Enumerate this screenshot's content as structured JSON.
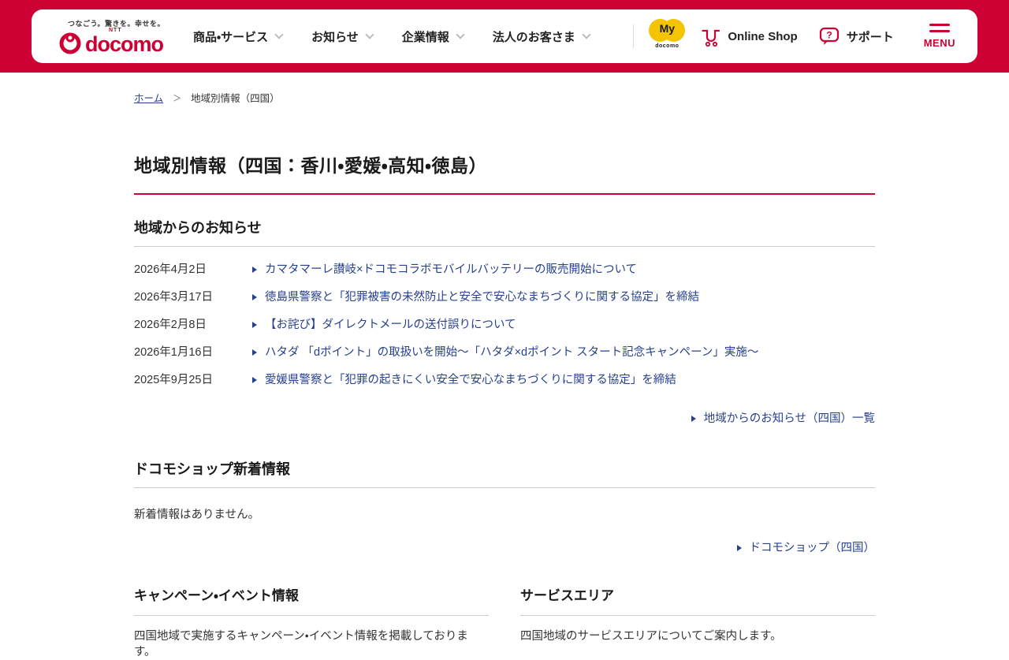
{
  "header": {
    "tagline": "つなごう。驚きを。幸せを。",
    "logo_ntt": "NTT",
    "logo_text": "docomo",
    "nav": [
      "商品・サービス",
      "お知らせ",
      "企業情報",
      "法人のお客さま"
    ],
    "my_docomo": {
      "my": "My",
      "sub": "docomo"
    },
    "online_shop_label": "Online Shop",
    "support_label": "サポート",
    "menu_label": "MENU"
  },
  "breadcrumb": {
    "home": "ホーム",
    "separator": "＞",
    "current": "地域別情報（四国）"
  },
  "page": {
    "title": "地域別情報（四国：香川・愛媛・高知・徳島）"
  },
  "news": {
    "heading": "地域からのお知らせ",
    "items": [
      {
        "date": "2026年4月2日",
        "title": "カマタマーレ讃岐×ドコモコラボモバイルバッテリーの販売開始について"
      },
      {
        "date": "2026年3月17日",
        "title": "徳島県警察と「犯罪被害の未然防止と安全で安心なまちづくりに関する協定」を締結"
      },
      {
        "date": "2026年2月8日",
        "title": "【お詫び】ダイレクトメールの送付誤りについて"
      },
      {
        "date": "2026年1月16日",
        "title": "ハタダ 「dポイント」の取扱いを開始～「ハタダ×dポイント スタート記念キャンペーン」実施～"
      },
      {
        "date": "2025年9月25日",
        "title": "愛媛県警察と「犯罪の起きにくい安全で安心なまちづくりに関する協定」を締結"
      }
    ],
    "more_link": "地域からのお知らせ（四国）一覧"
  },
  "shop_news": {
    "heading": "ドコモショップ新着情報",
    "empty_text": "新着情報はありません。",
    "more_link": "ドコモショップ（四国）"
  },
  "columns": [
    {
      "heading": "キャンペーン・イベント情報",
      "body": "四国地域で実施するキャンペーン・イベント情報を掲載しております。"
    },
    {
      "heading": "サービスエリア",
      "body": "四国地域のサービスエリアについてご案内します。"
    }
  ],
  "colors": {
    "brand_crimson": "#CC0033",
    "link_navy": "#27418F",
    "mydocomo_yellow": "#F5C400"
  }
}
